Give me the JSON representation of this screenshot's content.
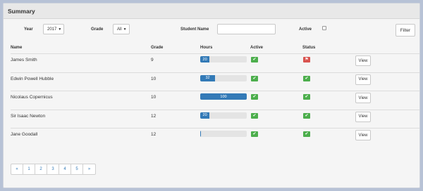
{
  "panel": {
    "title": "Summary"
  },
  "filters": {
    "year_label": "Year",
    "year_value": "2017",
    "grade_label": "Grade",
    "grade_value": "All",
    "student_name_label": "Student Name",
    "student_name_value": "",
    "active_label": "Active",
    "active_checked": false,
    "filter_button": "Filter"
  },
  "table": {
    "headers": {
      "name": "Name",
      "grade": "Grade",
      "hours": "Hours",
      "active": "Active",
      "status": "Status"
    },
    "rows": [
      {
        "name": "James Smith",
        "grade": "9",
        "hours": 20,
        "hours_label": "20",
        "active_icon": "check-icon",
        "status_icon": "flag-icon",
        "view": "View"
      },
      {
        "name": "Edwin Powell Hubble",
        "grade": "10",
        "hours": 32,
        "hours_label": "32",
        "active_icon": "check-icon",
        "status_icon": "check-icon",
        "view": "View"
      },
      {
        "name": "Nicolaus Copernicus",
        "grade": "10",
        "hours": 100,
        "hours_label": "100",
        "active_icon": "check-icon",
        "status_icon": "check-icon",
        "view": "View"
      },
      {
        "name": "Sir Isaac Newton",
        "grade": "12",
        "hours": 20,
        "hours_label": "20",
        "active_icon": "check-icon",
        "status_icon": "check-icon",
        "view": "View"
      },
      {
        "name": "Jane Goodall",
        "grade": "12",
        "hours": 0,
        "hours_label": "",
        "active_icon": "check-icon",
        "status_icon": "check-icon",
        "view": "View"
      }
    ]
  },
  "pagination": {
    "prev": "«",
    "pages": [
      "1",
      "2",
      "3",
      "4",
      "5"
    ],
    "next": "»"
  },
  "colors": {
    "progress": "#337ab7",
    "success": "#4cae4c",
    "danger": "#d9534f",
    "link": "#337ab7"
  }
}
